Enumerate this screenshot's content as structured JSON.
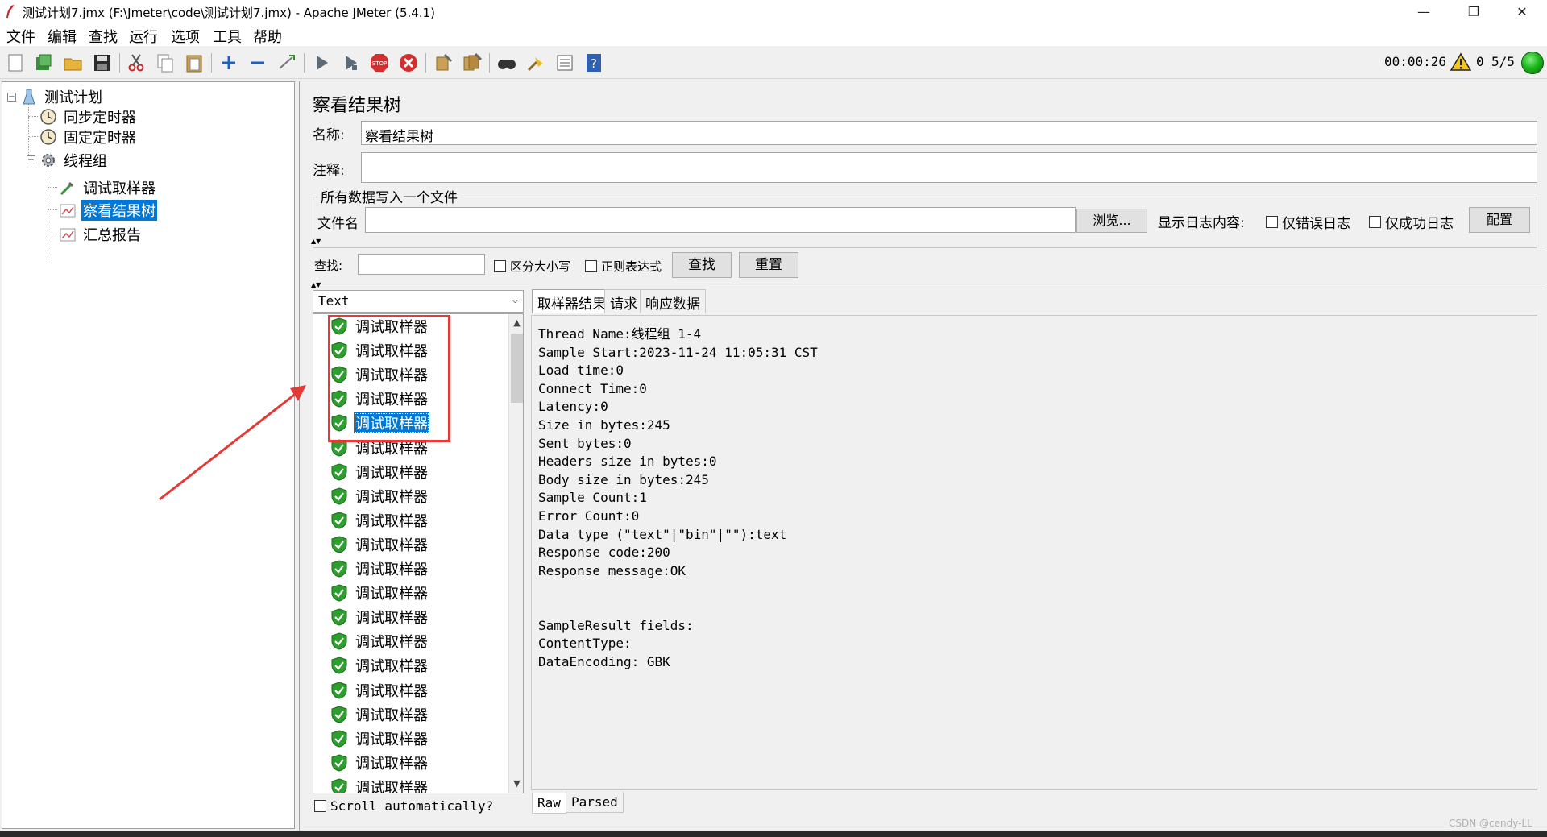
{
  "window": {
    "title": "测试计划7.jmx (F:\\Jmeter\\code\\测试计划7.jmx) - Apache JMeter (5.4.1)",
    "minimize": "—",
    "restore": "❐",
    "close": "✕"
  },
  "menu": {
    "items": [
      "文件",
      "编辑",
      "查找",
      "运行",
      "选项",
      "工具",
      "帮助"
    ]
  },
  "toolbar": {
    "timer": "00:00:26",
    "error_count": "0",
    "thread_count": "5/5",
    "icons": [
      "new-icon",
      "templates-icon",
      "open-icon",
      "save-icon",
      "cut-icon",
      "copy-icon",
      "paste-icon",
      "expand-icon",
      "collapse-icon",
      "toggle-icon",
      "start-icon",
      "start-no-pause-icon",
      "stop-icon",
      "shutdown-icon",
      "clear-icon",
      "clear-all-icon",
      "search-icon",
      "reset-search-icon",
      "function-helper-icon",
      "help-icon"
    ]
  },
  "tree": {
    "nodes": [
      {
        "label": "测试计划",
        "icon": "test-plan-icon"
      },
      {
        "label": "同步定时器",
        "icon": "timer-icon"
      },
      {
        "label": "固定定时器",
        "icon": "timer-icon"
      },
      {
        "label": "线程组",
        "icon": "gear-icon"
      },
      {
        "label": "调试取样器",
        "icon": "sampler-icon"
      },
      {
        "label": "察看结果树",
        "icon": "listener-icon"
      },
      {
        "label": "汇总报告",
        "icon": "listener-icon"
      }
    ]
  },
  "panel": {
    "title": "察看结果树",
    "name_label": "名称:",
    "name_value": "察看结果树",
    "comment_label": "注释:",
    "comment_value": "",
    "file_group_title": "所有数据写入一个文件",
    "filename_label": "文件名",
    "filename_value": "",
    "browse_button": "浏览...",
    "log_content_label": "显示日志内容:",
    "errors_only_label": "仅错误日志",
    "success_only_label": "仅成功日志",
    "configure_button": "配置",
    "search_label": "查找:",
    "search_value": "",
    "case_sensitive_label": "区分大小写",
    "regex_label": "正则表达式",
    "find_button": "查找",
    "reset_button": "重置"
  },
  "results": {
    "renderer": "Text",
    "items": [
      "调试取样器",
      "调试取样器",
      "调试取样器",
      "调试取样器",
      "调试取样器",
      "调试取样器",
      "调试取样器",
      "调试取样器",
      "调试取样器",
      "调试取样器",
      "调试取样器",
      "调试取样器",
      "调试取样器",
      "调试取样器",
      "调试取样器",
      "调试取样器",
      "调试取样器",
      "调试取样器",
      "调试取样器",
      "调试取样器"
    ],
    "selected_index": 4,
    "scroll_auto_label": "Scroll automatically?"
  },
  "detail": {
    "tabs": [
      "取样器结果",
      "请求",
      "响应数据"
    ],
    "active_tab": "取样器结果",
    "lines": [
      "Thread Name:线程组 1-4",
      "Sample Start:2023-11-24 11:05:31 CST",
      "Load time:0",
      "Connect Time:0",
      "Latency:0",
      "Size in bytes:245",
      "Sent bytes:0",
      "Headers size in bytes:0",
      "Body size in bytes:245",
      "Sample Count:1",
      "Error Count:0",
      "Data type (\"text\"|\"bin\"|\"\"):text",
      "Response code:200",
      "Response message:OK",
      "",
      "",
      "SampleResult fields:",
      "ContentType:",
      "DataEncoding: GBK"
    ],
    "bottom_tabs": [
      "Raw",
      "Parsed"
    ],
    "active_bottom_tab": "Raw"
  },
  "watermark": "CSDN @cendy-LL",
  "colors": {
    "selection": "#0078d7",
    "annotation": "#e53935",
    "success_shield": "#2e9e2e"
  }
}
